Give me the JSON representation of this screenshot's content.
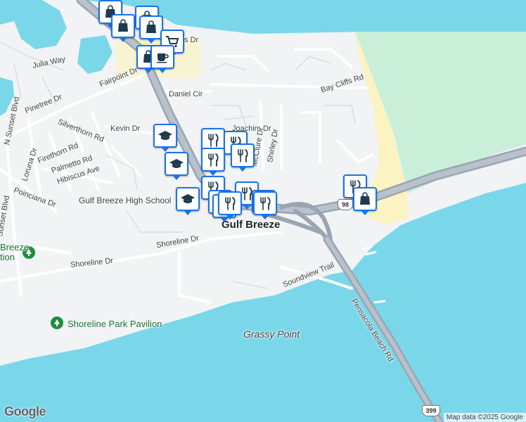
{
  "map": {
    "colors": {
      "water": "#7ad7ea",
      "land": "#f1f3f4",
      "park": "#c9efd9",
      "beach": "#fbf3c2",
      "highway": "#9aa5b1",
      "road": "#ffffff"
    },
    "roads": {
      "julia_way": "Julia Way",
      "fairpoint_dr": "Fairpoint Dr",
      "pinetree_dr": "Pinetree Dr",
      "n_sunset_blvd": "N Sunset Blvd",
      "daniel_cir": "Daniel Cir",
      "kevin_dr": "Kevin Dr",
      "silverthorn_rd": "Silverthorn Rd",
      "loruna_dr": "Loruna Dr",
      "firethorn_rd": "Firethorn Rd",
      "palmetto_rd": "Palmetto Rd",
      "hibiscus_ave": "Hibiscus Ave",
      "poinciana_dr": "Poinciana Dr",
      "sunset_blvd": "Sunset Blvd",
      "joachim_dr": "Joachim Dr",
      "mcclure_dr": "McClure Dr",
      "shirley_dr": "Shirley Dr",
      "bay_cliffs_rd": "Bay Cliffs Rd",
      "shoreline_dr": "Shoreline Dr",
      "shoreline_dr_2": "Shoreline Dr",
      "soundview_trail": "Soundview Trail",
      "pensacola_beach_rd": "Pensacola Beach Rd",
      "partial_dr": "s Dr"
    },
    "places": {
      "town": "Gulf Breeze",
      "grassy_point": "Grassy Point",
      "high_school": "Gulf Breeze High School",
      "shoreline_park": "Shoreline Park Pavilion",
      "left_park": "Breeze\ntion"
    },
    "route_shields": {
      "us98": "98",
      "sr399": "399"
    },
    "pins": [
      {
        "id": "shop-1",
        "icon": "shopping-bag-icon"
      },
      {
        "id": "shop-2",
        "icon": "shopping-bag-icon"
      },
      {
        "id": "shop-3",
        "icon": "shopping-bag-icon"
      },
      {
        "id": "shop-4",
        "icon": "shopping-bag-icon"
      },
      {
        "id": "cart-1",
        "icon": "shopping-cart-icon"
      },
      {
        "id": "shop-5",
        "icon": "shopping-bag-icon"
      },
      {
        "id": "cafe-1",
        "icon": "coffee-cup-icon"
      },
      {
        "id": "school-1",
        "icon": "graduation-cap-icon"
      },
      {
        "id": "school-2",
        "icon": "graduation-cap-icon"
      },
      {
        "id": "school-3",
        "icon": "graduation-cap-icon"
      },
      {
        "id": "food-1",
        "icon": "fork-knife-icon"
      },
      {
        "id": "food-2",
        "icon": "fork-knife-icon"
      },
      {
        "id": "food-3",
        "icon": "fork-knife-icon"
      },
      {
        "id": "food-4",
        "icon": "fork-knife-icon"
      },
      {
        "id": "food-5",
        "icon": "fork-knife-icon"
      },
      {
        "id": "food-6",
        "icon": "fork-knife-icon"
      },
      {
        "id": "food-7",
        "icon": "fork-knife-icon"
      },
      {
        "id": "food-8",
        "icon": "fork-knife-icon"
      },
      {
        "id": "food-9",
        "icon": "fork-knife-icon"
      },
      {
        "id": "food-10",
        "icon": "fork-knife-icon"
      },
      {
        "id": "food-11",
        "icon": "fork-knife-icon"
      },
      {
        "id": "food-12",
        "icon": "fork-knife-icon"
      },
      {
        "id": "shop-6",
        "icon": "shopping-bag-icon"
      }
    ],
    "logo": "Google",
    "attribution": "Map data ©2025 Google"
  }
}
